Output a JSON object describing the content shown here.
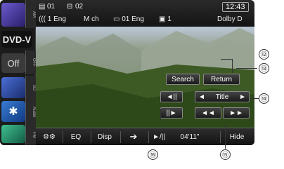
{
  "sidebar": {
    "tabs": [
      "AM",
      "OFF",
      "SD",
      "Audio",
      "FM"
    ],
    "dvd_label": "DVD-V",
    "off_label": "Off",
    "bluetooth_glyph": "✱"
  },
  "status": {
    "title_icon": "▤",
    "title_num": "01",
    "chapter_icon": "⊟",
    "chapter_num": "02",
    "clock": "12:43",
    "audio": "((( 1 Eng",
    "channels": "M ch",
    "subtitle": "▭ 01 Eng",
    "angle": "▣ 1",
    "dolby": "Dolby D"
  },
  "controls": {
    "search": "Search",
    "return": "Return",
    "title": "Title",
    "left_arrow": "◄",
    "right_arrow": "►",
    "prev": "◄||",
    "step": "||►",
    "rewind": "◄◄",
    "fastforward": "►►"
  },
  "bottom": {
    "settings": "⚙⚙",
    "eq": "EQ",
    "disp": "Disp",
    "arrow": "➔",
    "playpause": "►/||",
    "time": "04'11\"",
    "hide": "Hide"
  },
  "callouts": {
    "c12": "⑫",
    "c13": "⑬",
    "c14": "⑭",
    "c15": "⑮",
    "c16": "⑯"
  }
}
